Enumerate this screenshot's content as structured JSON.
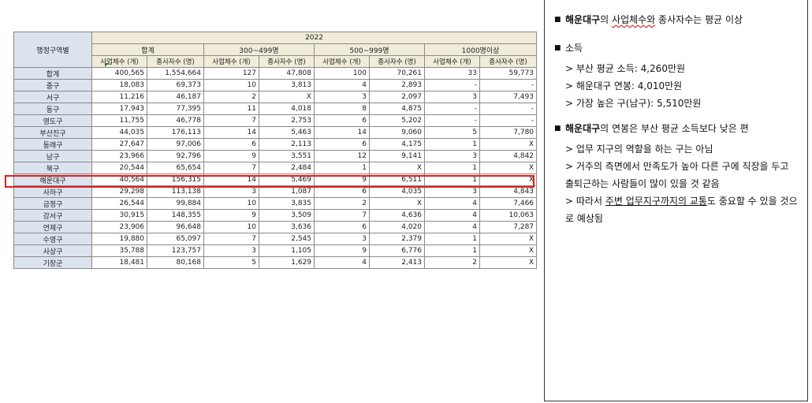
{
  "table": {
    "region_header": "행정구역별",
    "year": "2022",
    "groups": [
      "합계",
      "300~499명",
      "500~999명",
      "1000명이상"
    ],
    "sub_headers": [
      "사업체수 (개)",
      "종사자수 (명)",
      "사업체수 (개)",
      "종사자수 (명)",
      "사업체수 (개)",
      "종사자수 (명)",
      "사업체수 (개)",
      "종사자수 (명)"
    ],
    "rows": [
      {
        "region": "합계",
        "values": [
          "400,565",
          "1,554,664",
          "127",
          "47,808",
          "100",
          "70,261",
          "33",
          "59,773"
        ]
      },
      {
        "region": "중구",
        "values": [
          "18,083",
          "69,373",
          "10",
          "3,813",
          "4",
          "2,893",
          "-",
          "-"
        ]
      },
      {
        "region": "서구",
        "values": [
          "11,216",
          "46,187",
          "2",
          "X",
          "3",
          "2,097",
          "3",
          "7,493"
        ]
      },
      {
        "region": "동구",
        "values": [
          "17,943",
          "77,395",
          "11",
          "4,018",
          "8",
          "4,875",
          "-",
          "-"
        ]
      },
      {
        "region": "영도구",
        "values": [
          "11,755",
          "46,778",
          "7",
          "2,753",
          "6",
          "5,202",
          "-",
          "-"
        ]
      },
      {
        "region": "부산진구",
        "values": [
          "44,035",
          "176,113",
          "14",
          "5,463",
          "14",
          "9,060",
          "5",
          "7,780"
        ]
      },
      {
        "region": "동래구",
        "values": [
          "27,647",
          "97,006",
          "6",
          "2,113",
          "6",
          "4,175",
          "1",
          "X"
        ]
      },
      {
        "region": "남구",
        "values": [
          "23,966",
          "92,796",
          "9",
          "3,551",
          "12",
          "9,141",
          "3",
          "4,842"
        ]
      },
      {
        "region": "북구",
        "values": [
          "20,544",
          "65,654",
          "7",
          "2,484",
          "1",
          "X",
          "1",
          "X"
        ]
      },
      {
        "region": "해운대구",
        "values": [
          "40,564",
          "156,315",
          "14",
          "5,469",
          "9",
          "6,511",
          "1",
          "X"
        ]
      },
      {
        "region": "사하구",
        "values": [
          "29,298",
          "113,138",
          "3",
          "1,087",
          "6",
          "4,035",
          "3",
          "4,843"
        ]
      },
      {
        "region": "금정구",
        "values": [
          "26,544",
          "99,884",
          "10",
          "3,835",
          "2",
          "X",
          "4",
          "7,466"
        ]
      },
      {
        "region": "강서구",
        "values": [
          "30,915",
          "148,355",
          "9",
          "3,509",
          "7",
          "4,636",
          "4",
          "10,063"
        ]
      },
      {
        "region": "연제구",
        "values": [
          "23,906",
          "96,648",
          "10",
          "3,636",
          "6",
          "4,020",
          "4",
          "7,287"
        ]
      },
      {
        "region": "수영구",
        "values": [
          "19,880",
          "65,097",
          "7",
          "2,545",
          "3",
          "2,379",
          "1",
          "X"
        ]
      },
      {
        "region": "사상구",
        "values": [
          "35,788",
          "123,757",
          "3",
          "1,105",
          "9",
          "6,776",
          "1",
          "X"
        ]
      },
      {
        "region": "기장군",
        "values": [
          "18,481",
          "80,168",
          "5",
          "1,629",
          "4",
          "2,413",
          "2",
          "X"
        ]
      }
    ]
  },
  "notes": {
    "b1": {
      "bold": "해운대구",
      "mid": "의 ",
      "wavy": "사업체수와",
      "rest": " 종사자수는 평균 이상"
    },
    "b2": {
      "title": "소득",
      "lines": [
        "> 부산 평균 소득: 4,260만원",
        "> 해운대구 연봉: 4,010만원",
        "> 가장 높은 구(남구): 5,510만원"
      ]
    },
    "b3": {
      "bold": "해운대구",
      "rest": "의 연봉은 부산 평균 소득보다 낮은 편",
      "line1": "> 업무 지구의 역할을 하는 구는 아님",
      "line2": "> 거주의 측면에서 만족도가 높아 다른 구에 직장을 두고 출퇴근하는 사람들이 많이 있을 것 같음",
      "line3_pre": "> 따라서 ",
      "line3_ul": "주변 업무지구까지의 교통",
      "line3_post": "도 중요할 수 있을 것으로 예상됨"
    }
  },
  "colors": {
    "highlight": "#e0201e",
    "region_bg": "#dbe3ef",
    "header_bg": "#f1ecd9"
  }
}
